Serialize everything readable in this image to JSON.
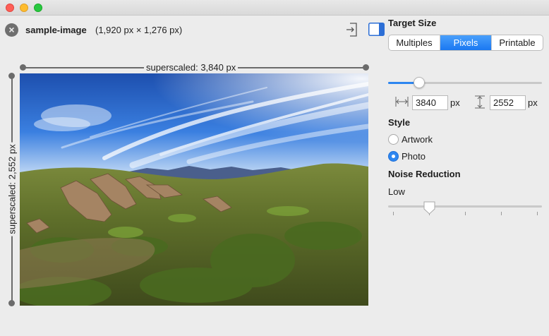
{
  "window": {
    "traffic_lights": [
      "close",
      "minimize",
      "zoom"
    ]
  },
  "header": {
    "file_name": "sample-image",
    "file_dimensions": "(1,920 px × 1,276 px)",
    "close_icon": "x-circle-icon",
    "export_icon": "export-icon",
    "sidebar_icon": "sidebar-toggle-icon"
  },
  "preview": {
    "width_label": "superscaled: 3,840 px",
    "height_label": "superscaled: 2,552 px"
  },
  "target_size": {
    "title": "Target Size",
    "modes": [
      "Multiples",
      "Pixels",
      "Printable"
    ],
    "selected_mode": "Pixels",
    "scale_fraction": 0.2,
    "width_value": "3840",
    "height_value": "2552",
    "unit": "px"
  },
  "style": {
    "title": "Style",
    "options": [
      "Artwork",
      "Photo"
    ],
    "selected": "Photo"
  },
  "noise_reduction": {
    "title": "Noise Reduction",
    "level_label": "Low",
    "level_fraction": 0.25,
    "steps": 5
  },
  "colors": {
    "accent": "#2d86f0",
    "window_bg": "#ececec",
    "line": "#6b6b6b"
  }
}
